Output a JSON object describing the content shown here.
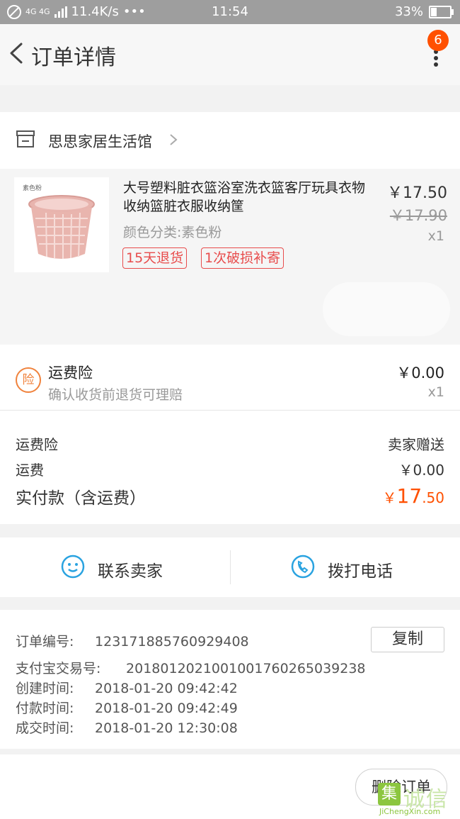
{
  "status_bar": {
    "network": "4G 4G",
    "speed": "11.4K/s",
    "dots": "•••",
    "time": "11:54",
    "battery": "33%"
  },
  "nav": {
    "title": "订单详情",
    "badge_count": "6"
  },
  "shop": {
    "name": "思思家居生活馆"
  },
  "product": {
    "image_label": "素色粉",
    "name": "大号塑料脏衣篮浴室洗衣篮客厅玩具衣物收纳篮脏衣服收纳筐",
    "price": "￥17.50",
    "original_price": "￥17.90",
    "quantity": "x1",
    "sku": "颜色分类:素色粉",
    "tags": [
      "15天退货",
      "1次破损补寄"
    ]
  },
  "insurance": {
    "icon_text": "险",
    "title": "运费险",
    "desc": "确认收货前退货可理赔",
    "price": "￥0.00",
    "quantity": "x1"
  },
  "summary": {
    "rows": [
      {
        "label": "运费险",
        "value": "卖家赠送"
      },
      {
        "label": "运费",
        "value": "￥0.00"
      }
    ],
    "total_label": "实付款（含运费）",
    "total_currency": "￥",
    "total_int": "17",
    "total_dec": ".50"
  },
  "contact": {
    "seller_label": "联系卖家",
    "phone_label": "拨打电话"
  },
  "order_info": {
    "order_no_label": "订单编号:",
    "order_no": "123171885760929408",
    "copy_label": "复制",
    "alipay_label": "支付宝交易号:",
    "alipay_no": "2018012021001001760265039238",
    "created_label": "创建时间:",
    "created": "2018-01-20 09:42:42",
    "paid_label": "付款时间:",
    "paid": "2018-01-20 09:42:49",
    "closed_label": "成交时间:",
    "closed": "2018-01-20 12:30:08"
  },
  "footer": {
    "delete_label": "删除订单"
  },
  "watermark": {
    "logo_char": "集",
    "text": "诚信",
    "url": "JiChengXin.com"
  },
  "colors": {
    "accent": "#ff5000",
    "tag_red": "#e84c4c",
    "icon_blue": "#2aa3e0",
    "insurance_orange": "#f0823c"
  }
}
